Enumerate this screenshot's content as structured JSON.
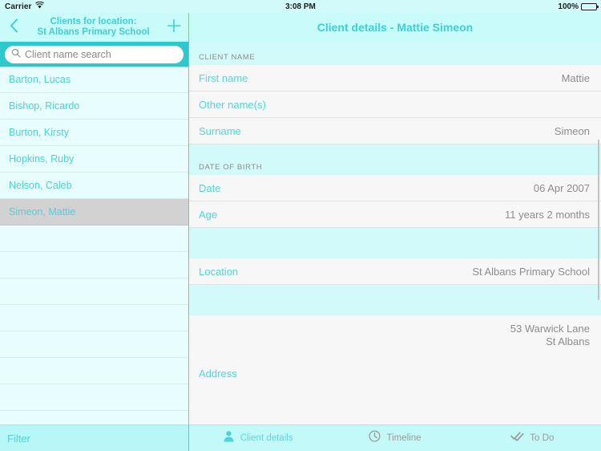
{
  "status_bar": {
    "carrier": "Carrier",
    "wifi_icon": "wifi-icon",
    "time": "3:08 PM",
    "battery_percent": "100%",
    "battery_icon": "battery-full-icon"
  },
  "sidebar": {
    "back_icon": "chevron-left-icon",
    "add_icon": "plus-icon",
    "title_line1": "Clients for location:",
    "title_line2": "St Albans Primary School",
    "search": {
      "icon": "search-icon",
      "value": "",
      "placeholder": "Client name search"
    },
    "clients": [
      {
        "name": "Barton, Lucas",
        "selected": false
      },
      {
        "name": "Bishop, Ricardo",
        "selected": false
      },
      {
        "name": "Burton, Kirsty",
        "selected": false
      },
      {
        "name": "Hopkins, Ruby",
        "selected": false
      },
      {
        "name": "Nelson, Caleb",
        "selected": false
      },
      {
        "name": "Simeon, Mattie",
        "selected": true
      }
    ],
    "empty_row_count": 8,
    "filter_label": "Filter"
  },
  "detail": {
    "title": "Client details - Mattie Simeon",
    "sections": [
      {
        "header": "CLIENT NAME",
        "rows": [
          {
            "label": "First name",
            "value": "Mattie"
          },
          {
            "label": "Other name(s)",
            "value": ""
          },
          {
            "label": "Surname",
            "value": "Simeon"
          }
        ]
      },
      {
        "header": "DATE OF BIRTH",
        "rows": [
          {
            "label": "Date",
            "value": "06 Apr 2007"
          },
          {
            "label": "Age",
            "value": "11 years 2 months"
          }
        ]
      },
      {
        "header": "",
        "rows": [
          {
            "label": "Location",
            "value": "St Albans Primary School"
          }
        ]
      },
      {
        "header": "",
        "rows": [
          {
            "label": "Address",
            "value": "53 Warwick Lane\nSt Albans",
            "tall": true
          }
        ]
      }
    ]
  },
  "tabbar": {
    "tabs": [
      {
        "label": "Client details",
        "icon": "person-icon",
        "active": true
      },
      {
        "label": "Timeline",
        "icon": "clock-icon",
        "active": false
      },
      {
        "label": "To Do",
        "icon": "check-icon",
        "active": false
      }
    ]
  },
  "colors": {
    "accent": "#4dd3d8",
    "header_bg": "#c9fbfb",
    "section_bg": "#d3fafa",
    "search_bg": "#2dc8cd",
    "row_bg": "#f7f7f7",
    "selected_row_bg": "#d2d2d2",
    "muted_text": "#8d8d8d"
  }
}
